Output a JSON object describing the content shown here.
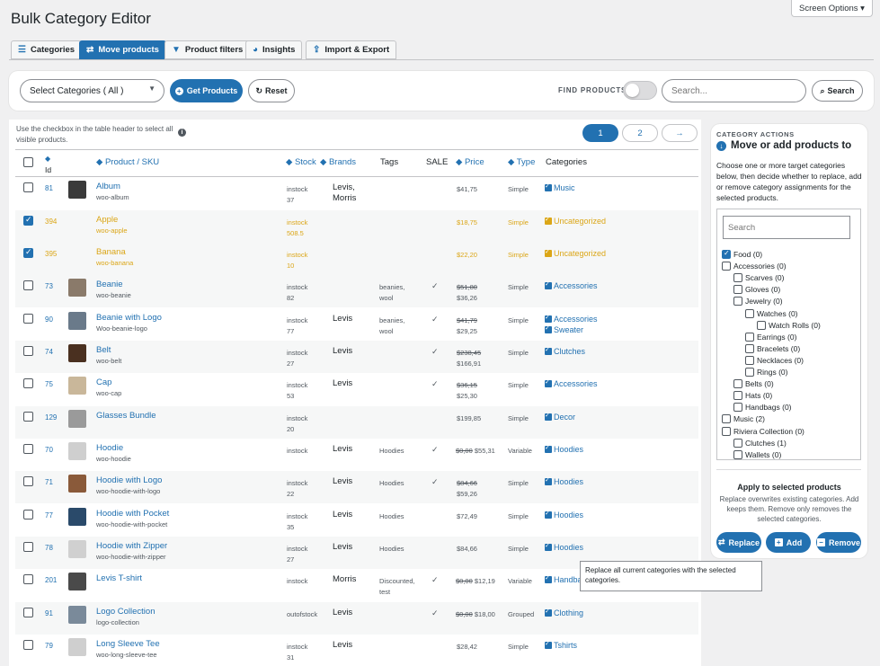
{
  "screen_options": "Screen Options ▾",
  "title": "Bulk Category Editor",
  "tabs": [
    {
      "label": "Categories",
      "icon": "list-icon"
    },
    {
      "label": "Move products",
      "icon": "arrows-icon"
    },
    {
      "label": "Product filters",
      "icon": "filter-icon"
    },
    {
      "label": "Insights",
      "icon": "pie-chart-icon"
    },
    {
      "label": "Import & Export",
      "icon": "upload-icon"
    }
  ],
  "toolbar": {
    "select_value": "Select Categories ( All )",
    "get_products": "Get Products",
    "reset": "Reset",
    "find_label": "FIND PRODUCTS",
    "search_placeholder": "Search...",
    "search_btn": "Search"
  },
  "hint": "Use the checkbox in the table header to select all visible products.",
  "pagination": {
    "p1": "1",
    "p2": "2",
    "next": "→"
  },
  "columns": {
    "id": "Id",
    "product": "Product / SKU",
    "stock": "Stock",
    "brands": "Brands",
    "tags": "Tags",
    "sale": "SALE",
    "price": "Price",
    "type": "Type",
    "categories": "Categories"
  },
  "rows": [
    {
      "id": "81",
      "name": "Album",
      "sku": "woo-album",
      "stock": "instock",
      "qty": "37",
      "brand": "Levis,",
      "brand2": "Morris",
      "tags": "",
      "tags2": "",
      "sale": "",
      "price_old": "",
      "price": "$41,75",
      "type": "Simple",
      "cats": [
        "Music"
      ],
      "checked": false
    },
    {
      "id": "394",
      "name": "Apple",
      "sku": "woo-apple",
      "stock": "instock",
      "qty": "508.5",
      "brand": "",
      "brand2": "",
      "tags": "",
      "tags2": "",
      "sale": "",
      "price_old": "",
      "price": "$18,75",
      "type": "Simple",
      "cats": [
        "Uncategorized"
      ],
      "checked": true
    },
    {
      "id": "395",
      "name": "Banana",
      "sku": "woo-banana",
      "stock": "instock",
      "qty": "10",
      "brand": "",
      "brand2": "",
      "tags": "",
      "tags2": "",
      "sale": "",
      "price_old": "",
      "price": "$22,20",
      "type": "Simple",
      "cats": [
        "Uncategorized"
      ],
      "checked": true
    },
    {
      "id": "73",
      "name": "Beanie",
      "sku": "woo-beanie",
      "stock": "instock",
      "qty": "82",
      "brand": "",
      "brand2": "",
      "tags": "beanies,",
      "tags2": "wool",
      "sale": "✓",
      "price_old": "$51,80",
      "price": "$36,26",
      "type": "Simple",
      "cats": [
        "Accessories"
      ],
      "checked": false
    },
    {
      "id": "90",
      "name": "Beanie with Logo",
      "sku": "Woo-beanie-logo",
      "stock": "instock",
      "qty": "77",
      "brand": "Levis",
      "brand2": "",
      "tags": "beanies,",
      "tags2": "wool",
      "sale": "✓",
      "price_old": "$41,79",
      "price": "$29,25",
      "type": "Simple",
      "cats": [
        "Accessories",
        "Sweater"
      ],
      "checked": false
    },
    {
      "id": "74",
      "name": "Belt",
      "sku": "woo-belt",
      "stock": "instock",
      "qty": "27",
      "brand": "Levis",
      "brand2": "",
      "tags": "",
      "tags2": "",
      "sale": "✓",
      "price_old": "$238,45",
      "price": "$166,91",
      "type": "Simple",
      "cats": [
        "Clutches"
      ],
      "checked": false
    },
    {
      "id": "75",
      "name": "Cap",
      "sku": "woo-cap",
      "stock": "instock",
      "qty": "53",
      "brand": "Levis",
      "brand2": "",
      "tags": "",
      "tags2": "",
      "sale": "✓",
      "price_old": "$36,15",
      "price": "$25,30",
      "type": "Simple",
      "cats": [
        "Accessories"
      ],
      "checked": false
    },
    {
      "id": "129",
      "name": "Glasses Bundle",
      "sku": "",
      "stock": "instock",
      "qty": "20",
      "brand": "",
      "brand2": "",
      "tags": "",
      "tags2": "",
      "sale": "",
      "price_old": "",
      "price": "$199,85",
      "type": "Simple",
      "cats": [
        "Decor"
      ],
      "checked": false
    },
    {
      "id": "70",
      "name": "Hoodie",
      "sku": "woo-hoodie",
      "stock": "instock",
      "qty": "",
      "brand": "Levis",
      "brand2": "",
      "tags": "Hoodies",
      "tags2": "",
      "sale": "✓",
      "price_old": "$0,00",
      "price": "$55,31",
      "type": "Variable",
      "cats": [
        "Hoodies"
      ],
      "checked": false
    },
    {
      "id": "71",
      "name": "Hoodie with Logo",
      "sku": "woo-hoodie-with-logo",
      "stock": "instock",
      "qty": "22",
      "brand": "Levis",
      "brand2": "",
      "tags": "Hoodies",
      "tags2": "",
      "sale": "✓",
      "price_old": "$84,66",
      "price": "$59,26",
      "type": "Simple",
      "cats": [
        "Hoodies"
      ],
      "checked": false
    },
    {
      "id": "77",
      "name": "Hoodie with Pocket",
      "sku": "woo-hoodie-with-pocket",
      "stock": "instock",
      "qty": "35",
      "brand": "Levis",
      "brand2": "",
      "tags": "Hoodies",
      "tags2": "",
      "sale": "",
      "price_old": "",
      "price": "$72,49",
      "type": "Simple",
      "cats": [
        "Hoodies"
      ],
      "checked": false
    },
    {
      "id": "78",
      "name": "Hoodie with Zipper",
      "sku": "woo-hoodie-with-zipper",
      "stock": "instock",
      "qty": "27",
      "brand": "Levis",
      "brand2": "",
      "tags": "Hoodies",
      "tags2": "",
      "sale": "",
      "price_old": "",
      "price": "$84,66",
      "type": "Simple",
      "cats": [
        "Hoodies"
      ],
      "checked": false
    },
    {
      "id": "201",
      "name": "Levis T-shirt",
      "sku": "",
      "stock": "instock",
      "qty": "",
      "brand": "Morris",
      "brand2": "",
      "tags": "Discounted,",
      "tags2": "test",
      "sale": "✓",
      "price_old": "$0,00",
      "price": "$12,19",
      "type": "Variable",
      "cats": [
        "Handba"
      ],
      "checked": false
    },
    {
      "id": "91",
      "name": "Logo Collection",
      "sku": "logo-collection",
      "stock": "outofstock",
      "qty": "",
      "brand": "Levis",
      "brand2": "",
      "tags": "",
      "tags2": "",
      "sale": "✓",
      "price_old": "$0,00",
      "price": "$18,00",
      "type": "Grouped",
      "cats": [
        "Clothing"
      ],
      "checked": false
    },
    {
      "id": "79",
      "name": "Long Sleeve Tee",
      "sku": "woo-long-sleeve-tee",
      "stock": "instock",
      "qty": "31",
      "brand": "Levis",
      "brand2": "",
      "tags": "",
      "tags2": "",
      "sale": "",
      "price_old": "",
      "price": "$28,42",
      "type": "Simple",
      "cats": [
        "Tshirts"
      ],
      "checked": false
    }
  ],
  "side": {
    "caption": "CATEGORY ACTIONS",
    "title": "Move or add products to",
    "desc": "Choose one or more target categories below, then decide whether to replace, add or remove category assignments for the selected products.",
    "search_placeholder": "Search",
    "tree": [
      {
        "label": "Food (0)",
        "checked": true
      },
      {
        "label": "Accessories (0)"
      },
      {
        "label": "Scarves (0)"
      },
      {
        "label": "Gloves (0)"
      },
      {
        "label": "Jewelry (0)"
      },
      {
        "label": "Watches (0)"
      },
      {
        "label": "Watch Rolls (0)"
      },
      {
        "label": "Earrings (0)"
      },
      {
        "label": "Bracelets (0)"
      },
      {
        "label": "Necklaces (0)"
      },
      {
        "label": "Rings (0)"
      },
      {
        "label": "Belts (0)"
      },
      {
        "label": "Hats (0)"
      },
      {
        "label": "Handbags (0)"
      },
      {
        "label": "Music (2)"
      },
      {
        "label": "Riviera Collection (0)"
      },
      {
        "label": "Clutches (1)"
      },
      {
        "label": "Wallets (0)"
      }
    ],
    "apply_title": "Apply to selected products",
    "apply_desc": "Replace overwrites existing categories. Add keeps them. Remove only removes the selected categories.",
    "replace": "Replace",
    "add": "Add",
    "remove": "Remove"
  },
  "tooltip": "Replace all current categories with the selected categories.",
  "colors": {
    "accent": "#2271b1",
    "selected": "#dba617"
  }
}
